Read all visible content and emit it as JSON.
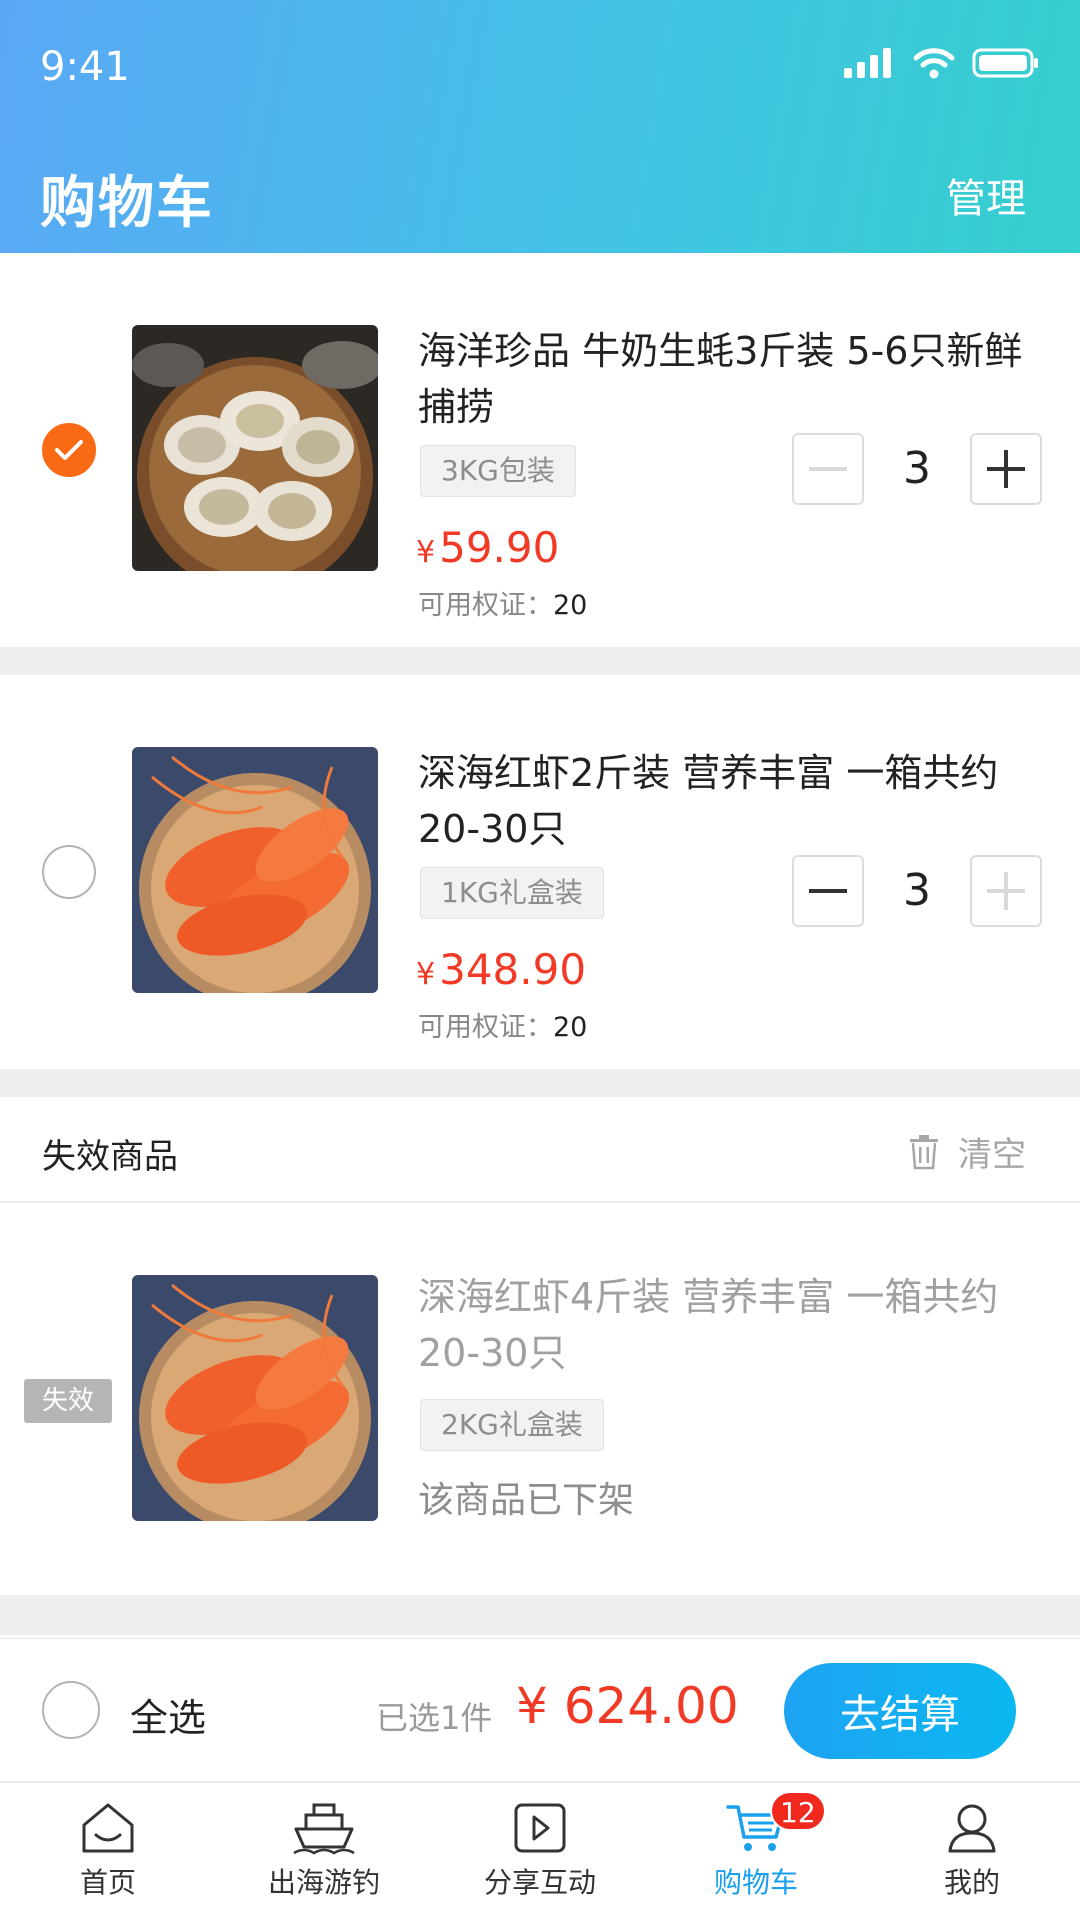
{
  "status_bar": {
    "time": "9:41"
  },
  "header": {
    "title": "购物车",
    "manage": "管理"
  },
  "items": [
    {
      "name": "海洋珍品  牛奶生蚝3斤装 5-6只新鲜捕捞",
      "spec": "3KG包装",
      "currency": "¥",
      "price": "59.90",
      "voucher_label": "可用权证：",
      "voucher_value": "20",
      "quantity": "3",
      "checked": true
    },
    {
      "name": "深海红虾2斤装  营养丰富    一箱共约20-30只",
      "spec": "1KG礼盒装",
      "currency": "¥",
      "price": "348.90",
      "voucher_label": "可用权证：",
      "voucher_value": "20",
      "quantity": "3",
      "checked": false
    }
  ],
  "invalid_section": {
    "title": "失效商品",
    "clear_label": "清空",
    "badge": "失效",
    "item": {
      "name": "深海红虾4斤装  营养丰富    一箱共约20-30只",
      "spec": "2KG礼盒装",
      "status": "该商品已下架"
    }
  },
  "checkout": {
    "select_all": "全选",
    "selected_count": "已选1件",
    "total": "¥ 624.00",
    "button": "去结算"
  },
  "tabbar": {
    "tabs": [
      {
        "label": "首页",
        "icon": "home-icon"
      },
      {
        "label": "出海游钓",
        "icon": "ship-icon"
      },
      {
        "label": "分享互动",
        "icon": "play-icon"
      },
      {
        "label": "购物车",
        "icon": "cart-icon",
        "badge": "12",
        "active": true
      },
      {
        "label": "我的",
        "icon": "user-icon"
      }
    ]
  },
  "colors": {
    "accent_orange": "#fa6a14",
    "price_red": "#f13a25",
    "active_blue": "#1aa0ee"
  }
}
